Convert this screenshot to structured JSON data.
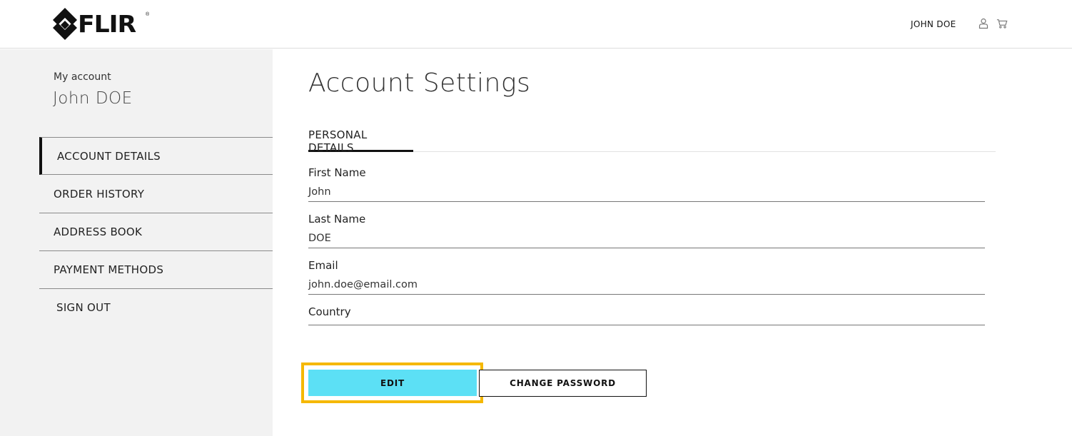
{
  "header": {
    "logo_text": "FLIR",
    "logo_registered": "®",
    "user_label": "JOHN DOE",
    "icons": [
      "user-icon",
      "cart-icon"
    ]
  },
  "sidebar": {
    "heading": "My account",
    "user_name": "John DOE",
    "items": [
      {
        "label": "ACCOUNT DETAILS",
        "active": true
      },
      {
        "label": "ORDER HISTORY",
        "active": false
      },
      {
        "label": "ADDRESS BOOK",
        "active": false
      },
      {
        "label": "PAYMENT METHODS",
        "active": false
      },
      {
        "label": "SIGN OUT",
        "active": false
      }
    ]
  },
  "main": {
    "title": "Account Settings",
    "tab": "PERSONAL DETAILS",
    "fields": [
      {
        "label": "First Name",
        "value": "John"
      },
      {
        "label": "Last Name",
        "value": "DOE"
      },
      {
        "label": "Email",
        "value": "john.doe@email.com"
      },
      {
        "label": "Country",
        "value": ""
      }
    ],
    "edit_button": "EDIT",
    "change_password_button": "CHANGE PASSWORD"
  },
  "colors": {
    "edit_button_bg": "#5ce0f5",
    "highlight_border": "#f5b800",
    "sidebar_bg": "#f2f2f2"
  }
}
